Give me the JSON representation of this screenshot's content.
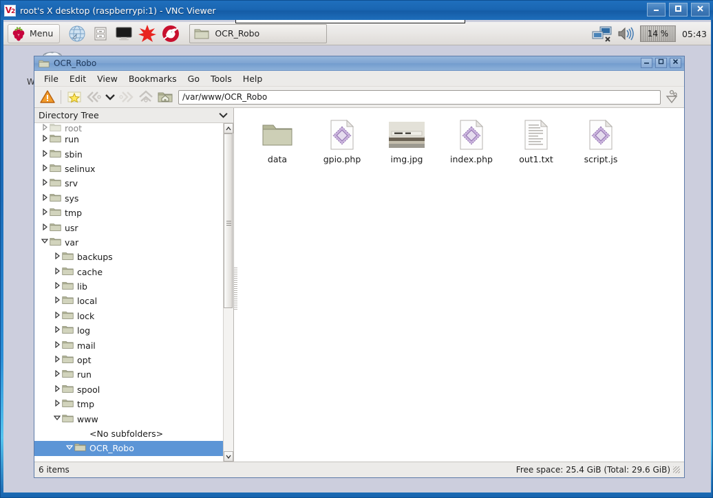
{
  "vnc": {
    "title": "root's X desktop (raspberrypi:1) - VNC Viewer",
    "logo": "vnc-logo",
    "minimize": "–",
    "maximize": "❑",
    "close": "✕"
  },
  "panel": {
    "menu_label": "Menu",
    "launchers": [
      {
        "name": "web-browser-icon"
      },
      {
        "name": "file-manager-icon"
      },
      {
        "name": "terminal-icon"
      },
      {
        "name": "mathematica-icon"
      },
      {
        "name": "wolfram-icon"
      }
    ],
    "taskbar": [
      {
        "label": "OCR_Robo",
        "icon": "folder-icon"
      }
    ],
    "tray": {
      "network_icon": "network-icon",
      "volume_icon": "volume-icon",
      "cpu_label": "14 %",
      "clock": "05:43"
    }
  },
  "desktop": {
    "icons": [
      {
        "label": "Wastebasket",
        "icon": "wastebasket-icon"
      }
    ]
  },
  "file_manager": {
    "title": "OCR_Robo",
    "title_icon": "folder-icon",
    "window_buttons": {
      "minimize": "–",
      "maximize": "❐",
      "close": "✕"
    },
    "menus": [
      "File",
      "Edit",
      "View",
      "Bookmarks",
      "Go",
      "Tools",
      "Help"
    ],
    "toolbar": {
      "warning_icon": "warning-triangle-icon",
      "bookmark_icon": "bookmark-star-icon",
      "back_icon": "back-arrow-icon",
      "history_icon": "chevron-down-icon",
      "forward_icon": "forward-arrow-icon",
      "up_icon": "up-arrow-icon",
      "home_icon": "home-folder-icon",
      "path_value": "/var/www/OCR_Robo",
      "path_placeholder": "/var/www/OCR_Robo",
      "extra_icon": "sort-options-icon"
    },
    "tree": {
      "header": "Directory Tree",
      "collapse_icon": "chevron-down-icon",
      "items": [
        {
          "label": "root",
          "depth": 1,
          "state": "collapsed",
          "clipped": true
        },
        {
          "label": "run",
          "depth": 1,
          "state": "collapsed"
        },
        {
          "label": "sbin",
          "depth": 1,
          "state": "collapsed"
        },
        {
          "label": "selinux",
          "depth": 1,
          "state": "collapsed"
        },
        {
          "label": "srv",
          "depth": 1,
          "state": "collapsed"
        },
        {
          "label": "sys",
          "depth": 1,
          "state": "collapsed"
        },
        {
          "label": "tmp",
          "depth": 1,
          "state": "collapsed"
        },
        {
          "label": "usr",
          "depth": 1,
          "state": "collapsed"
        },
        {
          "label": "var",
          "depth": 1,
          "state": "expanded"
        },
        {
          "label": "backups",
          "depth": 2,
          "state": "collapsed"
        },
        {
          "label": "cache",
          "depth": 2,
          "state": "collapsed"
        },
        {
          "label": "lib",
          "depth": 2,
          "state": "collapsed"
        },
        {
          "label": "local",
          "depth": 2,
          "state": "collapsed"
        },
        {
          "label": "lock",
          "depth": 2,
          "state": "collapsed"
        },
        {
          "label": "log",
          "depth": 2,
          "state": "collapsed"
        },
        {
          "label": "mail",
          "depth": 2,
          "state": "collapsed"
        },
        {
          "label": "opt",
          "depth": 2,
          "state": "collapsed"
        },
        {
          "label": "run",
          "depth": 2,
          "state": "collapsed"
        },
        {
          "label": "spool",
          "depth": 2,
          "state": "collapsed"
        },
        {
          "label": "tmp",
          "depth": 2,
          "state": "collapsed"
        },
        {
          "label": "www",
          "depth": 2,
          "state": "expanded"
        },
        {
          "label": "<No subfolders>",
          "depth": 3,
          "state": "none",
          "plain": true
        },
        {
          "label": "OCR_Robo",
          "depth": 3,
          "state": "expanded",
          "selected": true
        }
      ],
      "scrollbar": {
        "up": "▲",
        "down": "▼"
      }
    },
    "files": [
      {
        "name": "data",
        "type": "folder"
      },
      {
        "name": "gpio.php",
        "type": "php"
      },
      {
        "name": "img.jpg",
        "type": "image"
      },
      {
        "name": "index.php",
        "type": "php"
      },
      {
        "name": "out1.txt",
        "type": "text"
      },
      {
        "name": "script.js",
        "type": "php"
      }
    ],
    "status": {
      "items": "6 items",
      "free_space": "Free space: 25.4 GiB (Total: 29.6 GiB)"
    }
  },
  "colors": {
    "title_active": "#1763ae",
    "fm_title": "#7ea4d2",
    "selection": "#5c95d6",
    "folder": "#c3c5ac",
    "php_accent": "#a783c0",
    "warning": "#f0a030",
    "desktop_bg": "#cccedd"
  }
}
